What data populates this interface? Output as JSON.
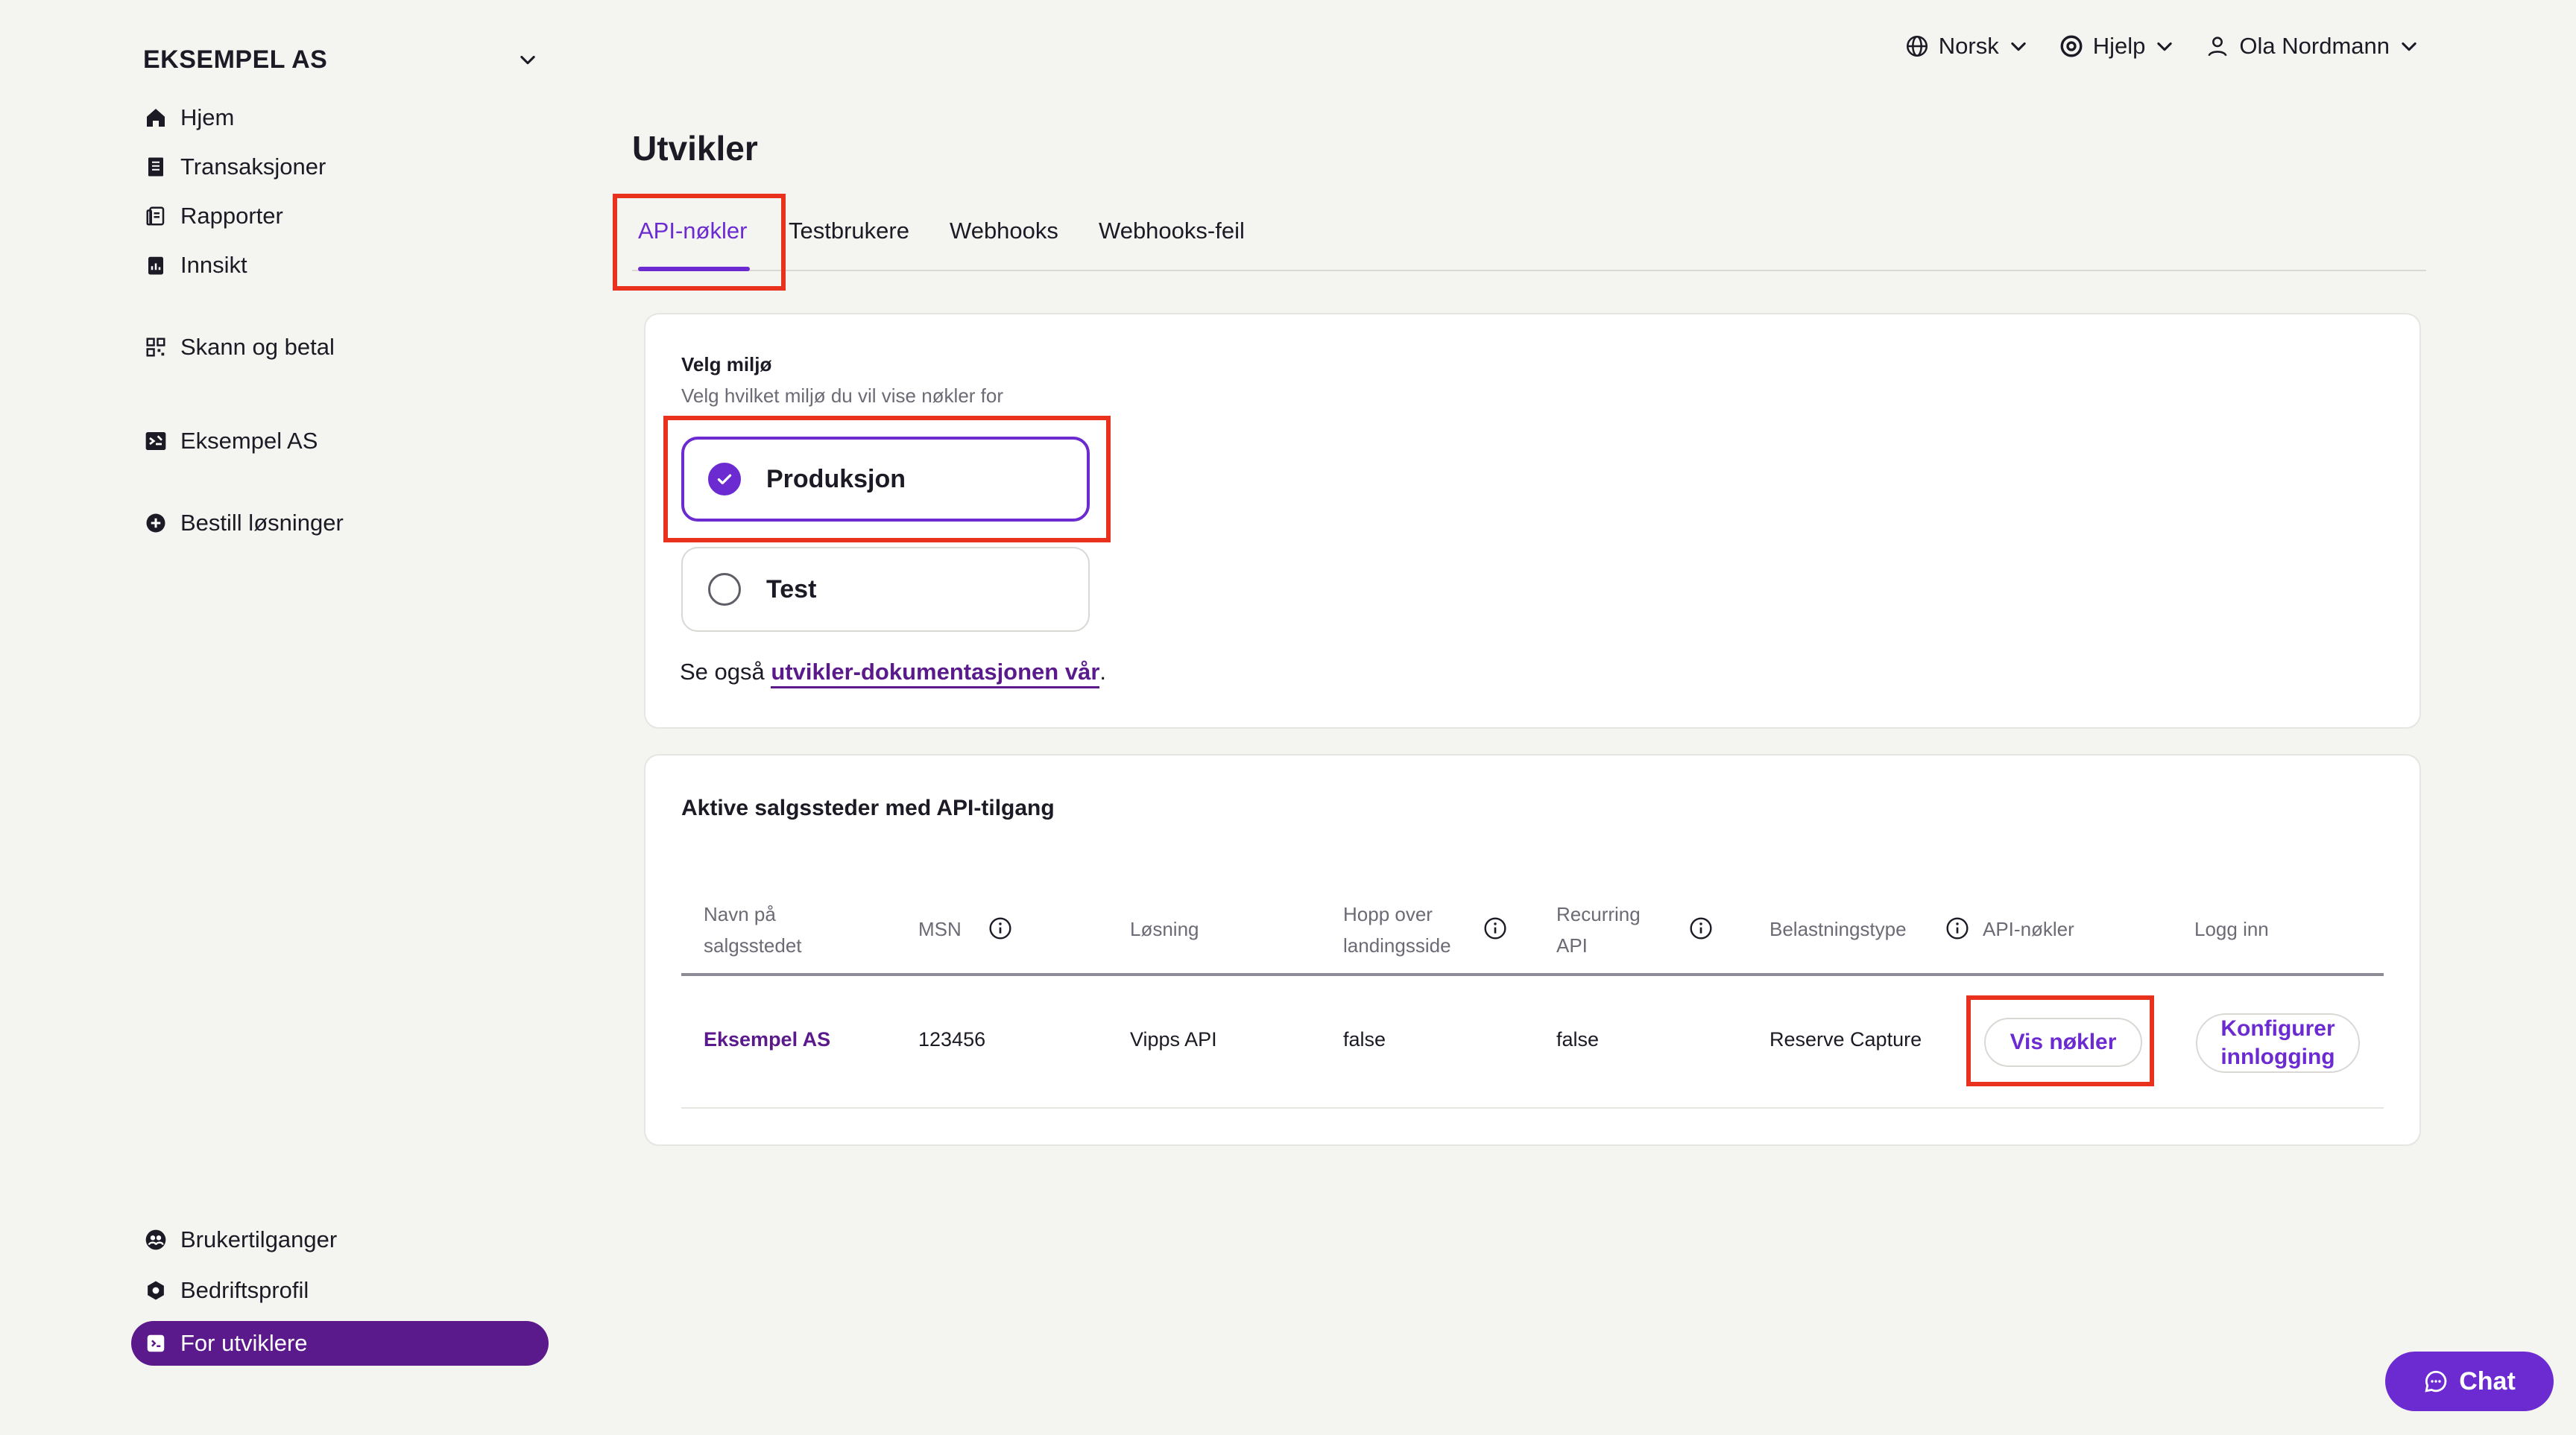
{
  "sidebar": {
    "org_name": "EKSEMPEL AS",
    "nav": [
      {
        "label": "Hjem",
        "icon": "home-icon"
      },
      {
        "label": "Transaksjoner",
        "icon": "receipt-icon"
      },
      {
        "label": "Rapporter",
        "icon": "reports-icon"
      },
      {
        "label": "Innsikt",
        "icon": "insights-icon"
      },
      {
        "label": "Skann og betal",
        "icon": "qr-icon"
      },
      {
        "label": "Eksempel AS",
        "icon": "store-icon"
      },
      {
        "label": "Bestill løsninger",
        "icon": "plus-circle-icon"
      }
    ],
    "bottom_nav": [
      {
        "label": "Brukertilganger",
        "icon": "users-icon"
      },
      {
        "label": "Bedriftsprofil",
        "icon": "company-icon"
      },
      {
        "label": "For utviklere",
        "icon": "terminal-icon",
        "active": true
      }
    ]
  },
  "topbar": {
    "language": "Norsk",
    "help": "Hjelp",
    "user": "Ola Nordmann"
  },
  "page": {
    "title": "Utvikler",
    "tabs": [
      "API-nøkler",
      "Testbrukere",
      "Webhooks",
      "Webhooks-feil"
    ],
    "active_tab": "API-nøkler"
  },
  "environment": {
    "heading": "Velg miljø",
    "subheading": "Velg hvilket miljø du vil vise nøkler for",
    "options": [
      "Produksjon",
      "Test"
    ],
    "selected": "Produksjon",
    "see_also_prefix": "Se også ",
    "see_also_link": "utvikler-dokumentasjonen vår",
    "see_also_suffix": "."
  },
  "sales_units": {
    "heading": "Aktive salgssteder med API-tilgang",
    "columns": [
      {
        "l1": "Navn på",
        "l2": "salgsstedet"
      },
      {
        "l1": "MSN",
        "l2": ""
      },
      {
        "l1": "Løsning",
        "l2": ""
      },
      {
        "l1": "Hopp over",
        "l2": "landingsside"
      },
      {
        "l1": "Recurring",
        "l2": "API"
      },
      {
        "l1": "Belastningstype",
        "l2": ""
      },
      {
        "l1": "API-nøkler",
        "l2": ""
      },
      {
        "l1": "Logg inn",
        "l2": ""
      }
    ],
    "rows": [
      {
        "name": "Eksempel AS",
        "msn": "123456",
        "solution": "Vipps API",
        "skip_landing": "false",
        "recurring": "false",
        "capture_type": "Reserve Capture",
        "keys_button": "Vis nøkler",
        "login_button_l1": "Konfigurer",
        "login_button_l2": "innlogging"
      }
    ]
  },
  "chat": {
    "label": "Chat"
  },
  "colors": {
    "accent": "#6b2bd1",
    "nav_active": "#5b1a8c",
    "highlight": "#e8321d"
  }
}
